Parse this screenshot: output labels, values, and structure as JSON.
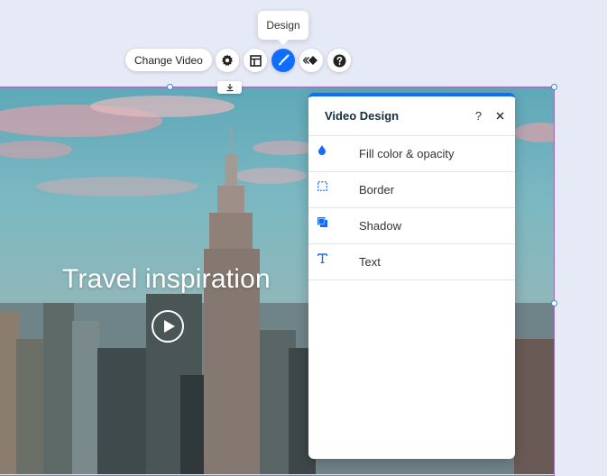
{
  "toolbar": {
    "tooltip": "Design",
    "change_video_label": "Change Video",
    "buttons": [
      {
        "icon": "gear-icon",
        "label": "Settings"
      },
      {
        "icon": "layout-icon",
        "label": "Layout"
      },
      {
        "icon": "brush-icon",
        "label": "Design",
        "active": true
      },
      {
        "icon": "animation-icon",
        "label": "Animation"
      },
      {
        "icon": "help-icon",
        "label": "Help"
      }
    ]
  },
  "video": {
    "title": "Travel inspiration",
    "play_icon": "play-icon"
  },
  "panel": {
    "title": "Video Design",
    "help": "?",
    "items": [
      {
        "icon": "drop-icon",
        "label": "Fill color & opacity"
      },
      {
        "icon": "border-icon",
        "label": "Border"
      },
      {
        "icon": "shadow-icon",
        "label": "Shadow"
      },
      {
        "icon": "text-icon",
        "label": "Text"
      }
    ]
  },
  "colors": {
    "accent": "#116dff",
    "canvas_bg": "#e6eaf6",
    "selection": "#9b6bb8"
  }
}
